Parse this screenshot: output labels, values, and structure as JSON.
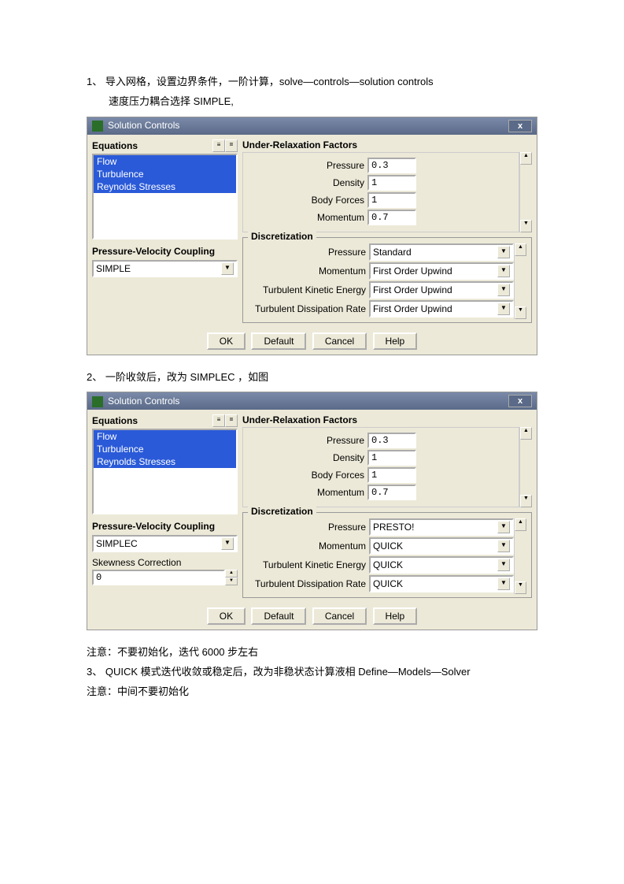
{
  "doc": {
    "line1_num": "1、",
    "line1": "导入网格，设置边界条件，一阶计算，solve—controls—solution controls",
    "line1b": "速度压力耦合选择 SIMPLE,",
    "line2_num": "2、",
    "line2": "一阶收敛后，改为 SIMPLEC ，如图",
    "note1": "注意：不要初始化，迭代 6000 步左右",
    "line3_num": "3、",
    "line3": "QUICK 模式迭代收敛或稳定后，改为非稳状态计算液相 Define—Models—Solver",
    "note2": "注意：中间不要初始化"
  },
  "dialog": {
    "title": "Solution Controls",
    "equations_label": "Equations",
    "equations": [
      "Flow",
      "Turbulence",
      "Reynolds Stresses"
    ],
    "pv_label": "Pressure-Velocity Coupling",
    "skew_label": "Skewness Correction",
    "urf_label": "Under-Relaxation Factors",
    "disc_label": "Discretization",
    "fields": {
      "pressure": "Pressure",
      "density": "Density",
      "body_forces": "Body Forces",
      "momentum": "Momentum",
      "tke": "Turbulent Kinetic Energy",
      "tdr": "Turbulent Dissipation Rate"
    },
    "buttons": {
      "ok": "OK",
      "default": "Default",
      "cancel": "Cancel",
      "help": "Help"
    }
  },
  "d1": {
    "pv": "SIMPLE",
    "urf": {
      "pressure": "0.3",
      "density": "1",
      "body_forces": "1",
      "momentum": "0.7"
    },
    "disc": {
      "pressure": "Standard",
      "momentum": "First Order Upwind",
      "tke": "First Order Upwind",
      "tdr": "First Order Upwind"
    }
  },
  "d2": {
    "pv": "SIMPLEC",
    "skew": "0",
    "urf": {
      "pressure": "0.3",
      "density": "1",
      "body_forces": "1",
      "momentum": "0.7"
    },
    "disc": {
      "pressure": "PRESTO!",
      "momentum": "QUICK",
      "tke": "QUICK",
      "tdr": "QUICK"
    }
  }
}
